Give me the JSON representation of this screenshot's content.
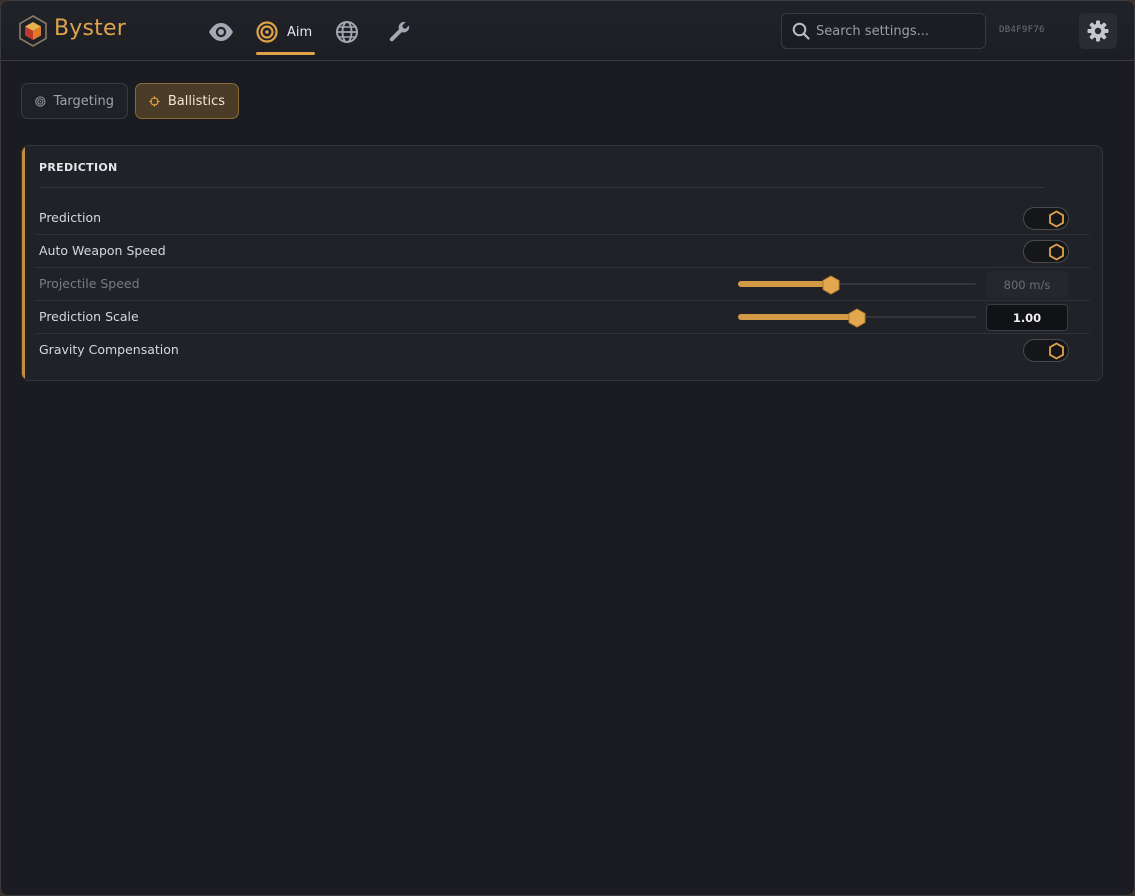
{
  "app": {
    "name": "Byster",
    "hwid": "DB4F9F76"
  },
  "nav": {
    "aim_label": "Aim"
  },
  "search": {
    "placeholder": "Search settings..."
  },
  "subtabs": {
    "targeting": "Targeting",
    "ballistics": "Ballistics"
  },
  "colors": {
    "accent": "#e0a24a",
    "background": "#1a1c22",
    "panel": "#202228"
  },
  "panel": {
    "title": "PREDICTION",
    "rows": [
      {
        "label": "Prediction",
        "control": "toggle",
        "enabled": true
      },
      {
        "label": "Auto Weapon Speed",
        "control": "toggle",
        "enabled": true
      },
      {
        "label": "Projectile Speed",
        "control": "slider",
        "value_text": "800 m/s",
        "fraction": 0.39,
        "disabled": true
      },
      {
        "label": "Prediction Scale",
        "control": "slider",
        "value_text": "1.00",
        "fraction": 0.5,
        "disabled": false
      },
      {
        "label": "Gravity Compensation",
        "control": "toggle",
        "enabled": true
      }
    ]
  }
}
